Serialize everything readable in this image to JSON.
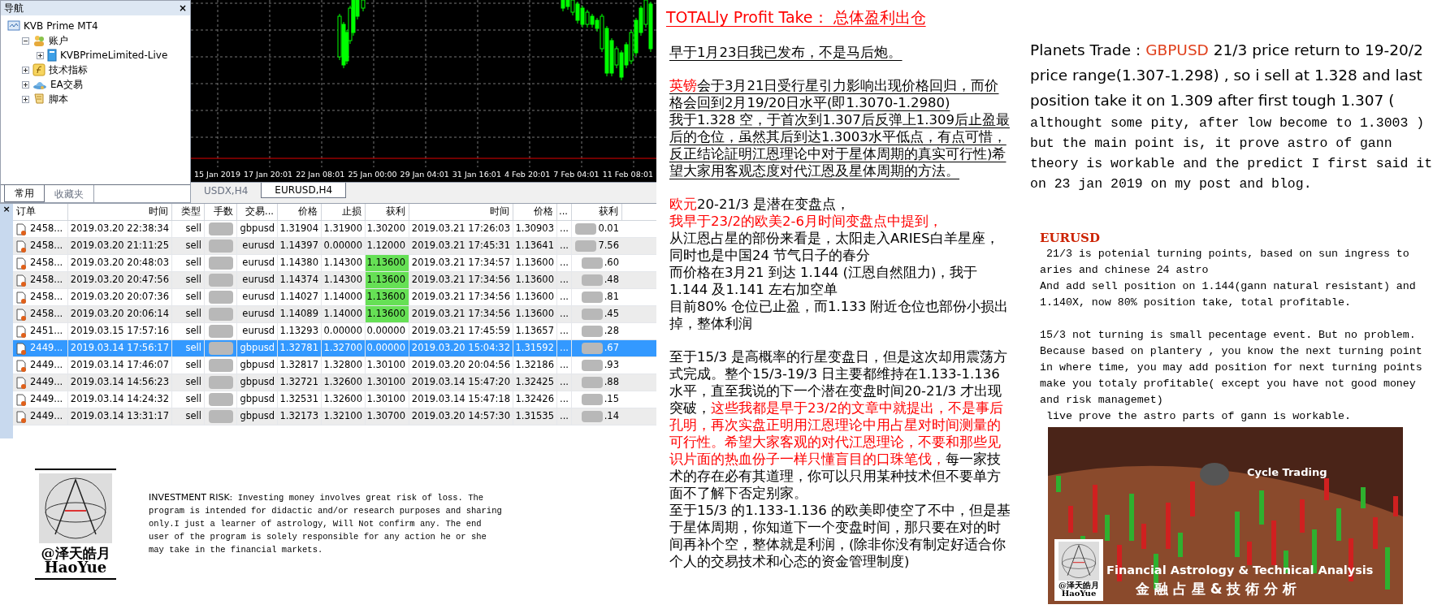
{
  "navigator": {
    "title": "导航",
    "close": "×",
    "tree": [
      {
        "label": "KVB Prime MT4",
        "children": [
          {
            "label": "账户",
            "expanded": true,
            "children": [
              {
                "label": "KVBPrimeLimited-Live",
                "expanded": false
              }
            ]
          },
          {
            "label": "技术指标",
            "expanded": false
          },
          {
            "label": "EA交易",
            "expanded": false
          },
          {
            "label": "脚本",
            "expanded": false
          }
        ]
      }
    ],
    "tabs": [
      {
        "label": "常用",
        "selected": true
      },
      {
        "label": "收藏夹",
        "selected": false
      }
    ]
  },
  "chart": {
    "x_labels": [
      "15 Jan 2019",
      "17 Jan 20:01",
      "22 Jan 08:01",
      "25 Jan 00:00",
      "29 Jan 04:01",
      "31 Jan 16:01",
      "4 Feb 20:01",
      "7 Feb 04:01",
      "11 Feb 08:01"
    ],
    "tabs": [
      {
        "label": "USDX,H4",
        "selected": false
      },
      {
        "label": "EURUSD,H4",
        "selected": true
      }
    ]
  },
  "terminal": {
    "close": "×",
    "columns": [
      "订单",
      "时间",
      "类型",
      "手数",
      "交易...",
      "价格",
      "止损",
      "获利",
      "时间",
      "价格",
      "...",
      "获利"
    ],
    "rows": [
      {
        "order": "2458...",
        "open_time": "2019.03.20 22:38:34",
        "type": "sell",
        "symbol": "gbpusd",
        "price": "1.31904",
        "sl": "1.31900",
        "tp": "1.30200",
        "tp_hit": false,
        "close_time": "2019.03.21 17:26:03",
        "close_price": "1.30903",
        "comment": "...",
        "profit": "0.01",
        "selected": false
      },
      {
        "order": "2458...",
        "open_time": "2019.03.20 21:11:25",
        "type": "sell",
        "symbol": "eurusd",
        "price": "1.14397",
        "sl": "0.00000",
        "tp": "1.12000",
        "tp_hit": false,
        "close_time": "2019.03.21 17:45:31",
        "close_price": "1.13641",
        "comment": "...",
        "profit": "7.56",
        "selected": false
      },
      {
        "order": "2458...",
        "open_time": "2019.03.20 20:48:03",
        "type": "sell",
        "symbol": "eurusd",
        "price": "1.14380",
        "sl": "1.14300",
        "tp": "1.13600",
        "tp_hit": true,
        "close_time": "2019.03.21 17:34:57",
        "close_price": "1.13600",
        "comment": "...",
        "profit": ".60",
        "selected": false
      },
      {
        "order": "2458...",
        "open_time": "2019.03.20 20:47:56",
        "type": "sell",
        "symbol": "eurusd",
        "price": "1.14374",
        "sl": "1.14300",
        "tp": "1.13600",
        "tp_hit": true,
        "close_time": "2019.03.21 17:34:56",
        "close_price": "1.13600",
        "comment": "...",
        "profit": ".48",
        "selected": false
      },
      {
        "order": "2458...",
        "open_time": "2019.03.20 20:07:36",
        "type": "sell",
        "symbol": "eurusd",
        "price": "1.14027",
        "sl": "1.14000",
        "tp": "1.13600",
        "tp_hit": true,
        "close_time": "2019.03.21 17:34:56",
        "close_price": "1.13600",
        "comment": "...",
        "profit": ".81",
        "selected": false
      },
      {
        "order": "2458...",
        "open_time": "2019.03.20 20:06:14",
        "type": "sell",
        "symbol": "eurusd",
        "price": "1.14089",
        "sl": "1.14000",
        "tp": "1.13600",
        "tp_hit": true,
        "close_time": "2019.03.21 17:34:56",
        "close_price": "1.13600",
        "comment": "...",
        "profit": ".45",
        "selected": false
      },
      {
        "order": "2451...",
        "open_time": "2019.03.15 17:57:16",
        "type": "sell",
        "symbol": "eurusd",
        "price": "1.13293",
        "sl": "0.00000",
        "tp": "0.00000",
        "tp_hit": false,
        "close_time": "2019.03.21 17:45:59",
        "close_price": "1.13657",
        "comment": "...",
        "profit": ".28",
        "selected": false
      },
      {
        "order": "2449...",
        "open_time": "2019.03.14 17:56:17",
        "type": "sell",
        "symbol": "gbpusd",
        "price": "1.32781",
        "sl": "1.32700",
        "tp": "0.00000",
        "tp_hit": false,
        "close_time": "2019.03.20 15:04:32",
        "close_price": "1.31592",
        "comment": "...",
        "profit": ".67",
        "selected": true
      },
      {
        "order": "2449...",
        "open_time": "2019.03.14 17:46:07",
        "type": "sell",
        "symbol": "gbpusd",
        "price": "1.32817",
        "sl": "1.32800",
        "tp": "1.30100",
        "tp_hit": false,
        "close_time": "2019.03.20 20:04:56",
        "close_price": "1.32186",
        "comment": "...",
        "profit": ".93",
        "selected": false
      },
      {
        "order": "2449...",
        "open_time": "2019.03.14 14:56:23",
        "type": "sell",
        "symbol": "gbpusd",
        "price": "1.32721",
        "sl": "1.32600",
        "tp": "1.30100",
        "tp_hit": false,
        "close_time": "2019.03.14 15:47:20",
        "close_price": "1.32425",
        "comment": "...",
        "profit": ".88",
        "selected": false
      },
      {
        "order": "2449...",
        "open_time": "2019.03.14 14:24:32",
        "type": "sell",
        "symbol": "gbpusd",
        "price": "1.32531",
        "sl": "1.32600",
        "tp": "1.30100",
        "tp_hit": false,
        "close_time": "2019.03.14 15:47:18",
        "close_price": "1.32426",
        "comment": "...",
        "profit": ".15",
        "selected": false
      },
      {
        "order": "2449...",
        "open_time": "2019.03.14 13:31:17",
        "type": "sell",
        "symbol": "gbpusd",
        "price": "1.32173",
        "sl": "1.32100",
        "tp": "1.30700",
        "tp_hit": false,
        "close_time": "2019.03.20 14:57:30",
        "close_price": "1.31535",
        "comment": "...",
        "profit": ".14",
        "selected": false
      }
    ]
  },
  "logo": {
    "name": "@泽天皓月",
    "latin": "HaoYue"
  },
  "disclaimer": {
    "label": "INVESTMENT RISK:",
    "text": " Investing money involves great risk of loss. The program is intended for didactic and/or research purposes and sharing only.I just a learner of astrology, Will Not confirm any.  The end user of the program is solely responsible for any action he or she may take in the financial markets."
  },
  "article_cn": {
    "title": "TOTALly Profit Take： 总体盈利出仓",
    "blocks": [
      {
        "underlined": true,
        "paragraphs": [
          [
            {
              "text": "早于1月23日我已发布，不是马后炮。",
              "highlight": false
            }
          ]
        ]
      },
      {
        "underlined": true,
        "paragraphs": [
          [
            {
              "text": "英镑",
              "highlight": true
            },
            {
              "text": "会于3月21日受行星引力影响出现价格回归，而价格会回到2月19/20日水平(即1.3070-1.2980)",
              "highlight": false
            }
          ],
          [
            {
              "text": "我于1.328 空，于首次到1.307后反弹上1.309后止盈最后的仓位，虽然其后到达1.3003水平低点，有点可惜，反正结论証明江恩理论中对于星体周期的真实可行性)希望大家用客观态度对代江恩及星体周期的方法。",
              "highlight": false
            }
          ]
        ]
      },
      {
        "underlined": false,
        "paragraphs": [
          [
            {
              "text": "欧元",
              "highlight": true
            },
            {
              "text": "20-21/3 是潜在变盘点，",
              "highlight": false
            }
          ],
          [
            {
              "text": "我早于23/2的欧美2-6月时间变盘点中提到，",
              "highlight": true
            }
          ],
          [
            {
              "text": "从江恩占星的部份来看是，太阳走入ARIES白羊星座，同时也是中国24 节气日子的春分",
              "highlight": false
            }
          ],
          [
            {
              "text": "而价格在3月21 到达 1.144 (江恩自然阻力)，我于1.144 及1.141 左右加空单",
              "highlight": false
            }
          ],
          [
            {
              "text": "目前80% 仓位已止盈，而1.133 附近仓位也部份小损出掉，整体利润",
              "highlight": false
            }
          ]
        ]
      },
      {
        "underlined": false,
        "paragraphs": [
          [
            {
              "text": "至于15/3 是高概率的行星变盘日，但是这次却用震荡方式完成。整个15/3-19/3 日主要都维持在1.133-1.136水平，直至我说的下一个潜在变盘时间20-21/3 才出现突破，",
              "highlight": false
            },
            {
              "text": "这些我都是早于23/2的文章中就提出，不是事后孔明，再次实盘正明用江恩理论中用占星对时间测量的可行性。希望大家客观的对代江恩理论，不要和那些见识片面的热血份子一样只懂盲目的口珠笔伐，",
              "highlight": true
            },
            {
              "text": "每一家技术的存在必有其道理，你可以只用某种技术但不要单方面不了解下否定别家。",
              "highlight": false
            }
          ],
          [
            {
              "text": "至于15/3 的1.133-1.136 的欧美即使空了不中，但是基于星体周期，你知道下一个变盘时间，那只要在对的时间再补个空，整体就是利润，(除非你没有制定好适合你个人的交易技术和心态的资金管理制度)",
              "highlight": false
            }
          ]
        ]
      }
    ]
  },
  "article_en": {
    "intro": [
      {
        "text": "Planets Trade : ",
        "highlight": false
      },
      {
        "text": "GBPUSD",
        "highlight": true
      },
      {
        "text": " 21/3 price return to 19-20/2 price range(1.307-1.298) , so i sell at 1.328 and last position take it on 1.309 after first tough 1.307 (",
        "highlight": false
      }
    ],
    "intro_cont": "althought some pity, after low become to 1.3003 ) but the main point is, it prove astro of gann theory is workable and the predict I first said it on 23 jan 2019 on my post and blog.",
    "eur_title": "EURUSD",
    "eur_paragraphs": [
      " 21/3 is potenial turning points, based on sun ingress to aries and chinese 24 astro",
      "And add sell position on 1.144(gann natural resistant) and 1.140X, now 80% position take, total profitable.",
      "15/3 not turning is small pecentage event. But no problem. Because based on plantery , you know the next turning point in where time, you may add position for next turning points make you totaly profitable( except you have not good money and risk managemet)",
      " live prove the astro parts of gann is workable."
    ]
  },
  "banner": {
    "caption": "Cycle Trading",
    "title": "Financial Astrology & Technical Analysis",
    "subtitle": "金 融 占 星 & 技 術 分 析",
    "logo_name": "@泽天皓月",
    "logo_latin": "HaoYue"
  }
}
